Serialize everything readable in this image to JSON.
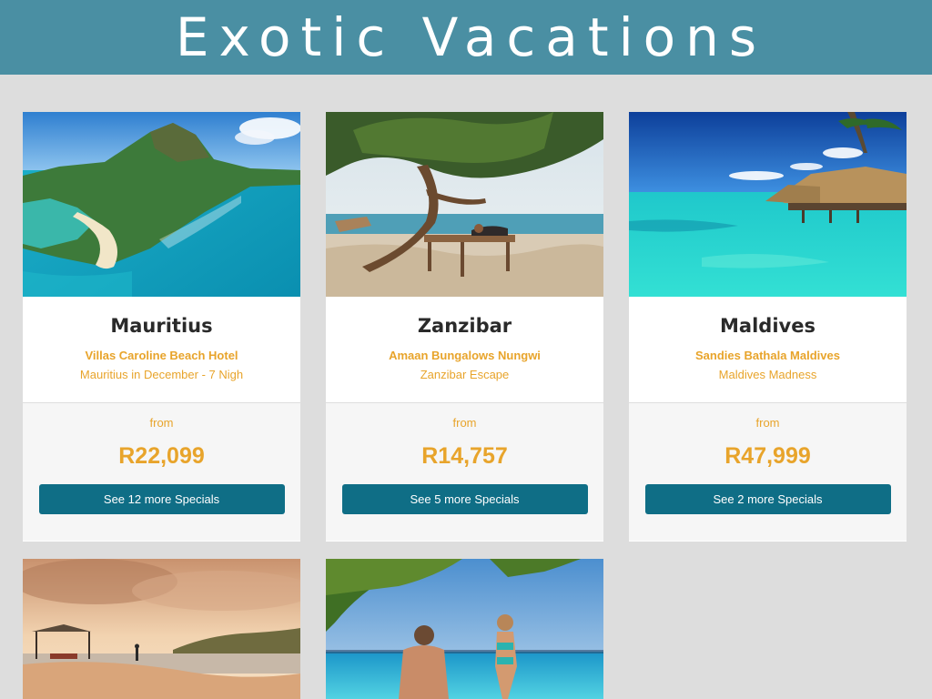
{
  "header": {
    "title": "Exotic Vacations"
  },
  "cards": [
    {
      "destination": "Mauritius",
      "hotel": "Villas Caroline Beach Hotel",
      "offer": "Mauritius in December - 7 Nigh",
      "from_label": "from",
      "price": "R22,099",
      "button_label": "See 12 more Specials"
    },
    {
      "destination": "Zanzibar",
      "hotel": "Amaan Bungalows Nungwi",
      "offer": "Zanzibar Escape",
      "from_label": "from",
      "price": "R14,757",
      "button_label": "See 5 more Specials"
    },
    {
      "destination": "Maldives",
      "hotel": "Sandies Bathala Maldives",
      "offer": "Maldives Madness",
      "from_label": "from",
      "price": "R47,999",
      "button_label": "See 2 more Specials"
    }
  ],
  "colors": {
    "banner": "#4a8fa3",
    "accent": "#e8a42b",
    "button": "#0f6e86",
    "page_background": "#dddddd"
  }
}
